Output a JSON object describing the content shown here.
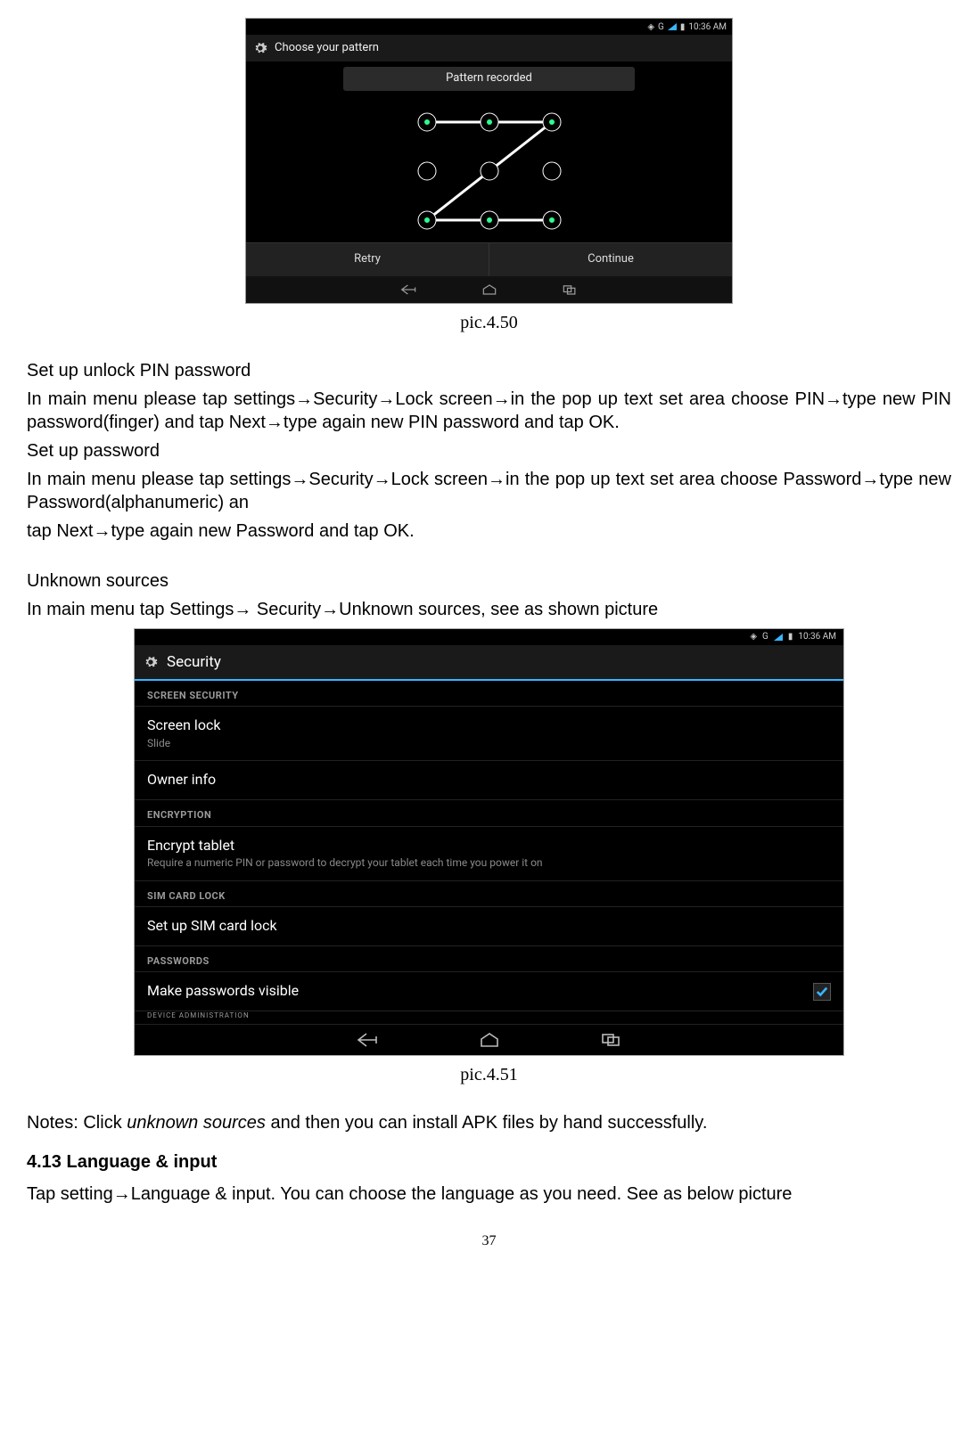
{
  "shot1": {
    "status_time": "10:36 AM",
    "status_g": "G",
    "appbar_title": "Choose your pattern",
    "toast": "Pattern recorded",
    "btn_retry": "Retry",
    "btn_continue": "Continue"
  },
  "caption1": "pic.4.50",
  "body": {
    "p1": "Set up unlock PIN password",
    "p2": "In main menu please tap settings→Security→Lock screen→in the pop up text set area choose PIN→type new PIN password(finger) and tap Next→type again new PIN password and tap OK.",
    "p3": "Set up password",
    "p4": "In main menu please tap settings→Security→Lock screen→in the pop up text set area choose Password→type new Password(alphanumeric) an",
    "p5": "tap Next→type again new Password and tap OK.",
    "p6": "Unknown sources",
    "p7": "In main menu tap Settings→ Security→Unknown sources, see as shown picture"
  },
  "shot2": {
    "status_time": "10:36 AM",
    "status_g": "G",
    "appbar_title": "Security",
    "cat1": "SCREEN SECURITY",
    "item_screenlock_title": "Screen lock",
    "item_screenlock_sub": "Slide",
    "item_owner_title": "Owner info",
    "cat2": "ENCRYPTION",
    "item_encrypt_title": "Encrypt tablet",
    "item_encrypt_sub": "Require a numeric PIN or password to decrypt your tablet each time you power it on",
    "cat3": "SIM CARD LOCK",
    "item_sim_title": "Set up SIM card lock",
    "cat4": "PASSWORDS",
    "item_pwvis_title": "Make passwords visible",
    "cutoff_cat": "DEVICE ADMINISTRATION"
  },
  "caption2": "pic.4.51",
  "notes_pre": "Notes: Click ",
  "notes_italic": "unknown sources",
  "notes_post": " and then you can install APK files by hand successfully.",
  "section413": "4.13 Language & input",
  "p413": "Tap setting→Language & input. You can choose the language as you need. See as below picture",
  "page_number": "37"
}
